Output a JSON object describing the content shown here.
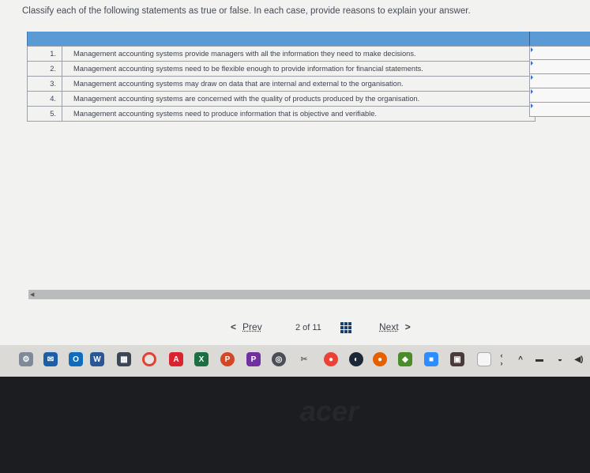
{
  "question": {
    "instruction": "Classify each of the following statements as true or false. In each case, provide reasons to explain your answer."
  },
  "statements": [
    {
      "num": "1.",
      "text": "Management accounting systems provide managers with all the information they need to make decisions."
    },
    {
      "num": "2.",
      "text": "Management accounting systems need to be flexible enough to provide information for financial statements."
    },
    {
      "num": "3.",
      "text": "Management accounting systems may draw on data that are internal and external to the organisation."
    },
    {
      "num": "4.",
      "text": "Management accounting systems are concerned with the quality of products produced by the organisation."
    },
    {
      "num": "5.",
      "text": "Management accounting systems need to produce information that is objective and verifiable."
    }
  ],
  "pagination": {
    "prev_label": "Prev",
    "page_text": "2 of 11",
    "next_label": "Next"
  },
  "taskbar": {
    "icons": [
      "settings-icon",
      "mail-icon",
      "outlook-icon",
      "word-icon",
      "calculator-icon",
      "chrome-icon",
      "acrobat-icon",
      "excel-icon",
      "powerpoint-icon",
      "publisher-icon",
      "camera-icon",
      "tools-icon",
      "maps-icon",
      "steam-icon",
      "firefox-icon",
      "layers-icon",
      "zoom-icon",
      "media-icon",
      "file-icon"
    ]
  },
  "brand": {
    "text": "acer"
  },
  "colors": {
    "header_blue": "#5b9bd5",
    "screen_bg": "#f2f3f1",
    "taskbar_bg": "#dcdad6"
  }
}
